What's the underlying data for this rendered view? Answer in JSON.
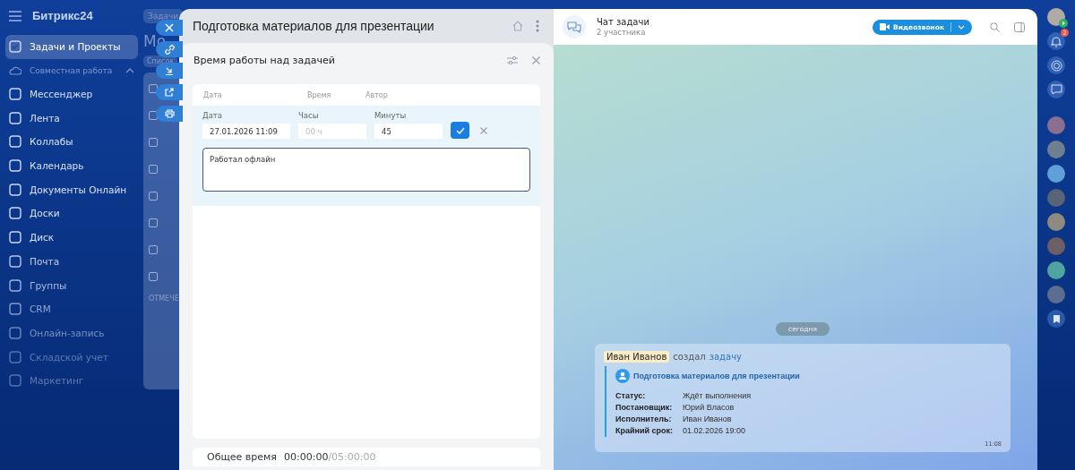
{
  "brand": {
    "name": "Битрикс24"
  },
  "sidebar": {
    "items": [
      {
        "label": "Задачи и Проекты",
        "kind": "item",
        "selected": true
      },
      {
        "label": "Совместная работа",
        "kind": "section",
        "expanded": true
      },
      {
        "label": "Мессенджер",
        "kind": "item",
        "selected": false
      },
      {
        "label": "Лента",
        "kind": "item",
        "selected": false
      },
      {
        "label": "Коллабы",
        "kind": "item",
        "selected": false
      },
      {
        "label": "Календарь",
        "kind": "item",
        "selected": false
      },
      {
        "label": "Документы Онлайн",
        "kind": "item",
        "selected": false
      },
      {
        "label": "Доски",
        "kind": "item",
        "selected": false
      },
      {
        "label": "Диск",
        "kind": "item",
        "selected": false
      },
      {
        "label": "Почта",
        "kind": "item",
        "selected": false
      },
      {
        "label": "Группы",
        "kind": "item",
        "selected": false
      },
      {
        "label": "CRM",
        "kind": "item",
        "selected": false
      },
      {
        "label": "Онлайн-запись",
        "kind": "item",
        "selected": false
      },
      {
        "label": "Складской учет",
        "kind": "item",
        "selected": false
      },
      {
        "label": "Маркетинг",
        "kind": "item",
        "selected": false
      }
    ]
  },
  "background_page": {
    "tab": "Задачи",
    "heading": "Мо",
    "view": "Список",
    "footer": "ОТМЕЧЕ",
    "rows": [
      {
        "checked": false
      },
      {
        "checked": false
      },
      {
        "checked": false
      },
      {
        "checked": false
      },
      {
        "checked": false
      },
      {
        "checked": false
      },
      {
        "checked": false
      },
      {
        "checked": false
      }
    ]
  },
  "task_panel": {
    "title": "Подготовка материалов для презентации",
    "time_tracking": {
      "title": "Время работы над задачей",
      "columns": [
        "Дата",
        "Время",
        "Автор"
      ],
      "edit_row": {
        "date_label": "Дата",
        "date_value": "27.01.2026 11:09",
        "hours_label": "Часы",
        "hours_placeholder": "00 ч",
        "minutes_label": "Минуты",
        "minutes_value": "45",
        "comment": "Работал офлайн"
      },
      "total_label": "Общее время",
      "total_value": "00:00:00",
      "total_limit": "/05:00:00"
    }
  },
  "chat": {
    "title": "Чат задачи",
    "subtitle": "2 участника",
    "video_button": "Видеозвонок",
    "date_divider": "сегодня",
    "message": {
      "author": "Иван Иванов",
      "action": "создал",
      "link": "задачу",
      "task_title": "Подготовка материалов для презентации",
      "fields": [
        {
          "label": "Статус:",
          "value": "Ждёт выполнения"
        },
        {
          "label": "Постановщик:",
          "value": "Юрий Власов"
        },
        {
          "label": "Исполнитель:",
          "value": "Иван Иванов"
        },
        {
          "label": "Крайний срок:",
          "value": "01.02.2026 19:00"
        }
      ],
      "time": "11:08"
    }
  },
  "right_rail": {
    "notifications_badge": "2"
  }
}
